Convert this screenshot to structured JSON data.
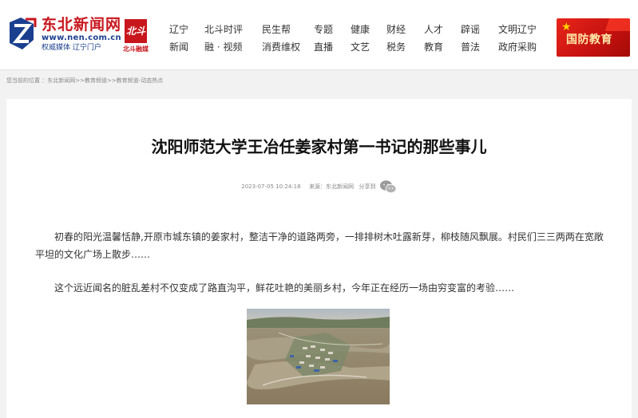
{
  "site": {
    "name": "东北新闻网",
    "url": "www.nen.com.cn",
    "tagline": "权威媒体  辽宁门户",
    "partner_mark": "北斗",
    "partner_label": "北斗融媒"
  },
  "nav": {
    "row1": [
      "辽宁",
      "北斗时评",
      "民生帮",
      "专题",
      "健康",
      "财经",
      "人才",
      "辟谣",
      "文明辽宁"
    ],
    "row2": [
      "新闻",
      "融 · 视频",
      "消费维权",
      "直播",
      "文艺",
      "税务",
      "教育",
      "普法",
      "政府采购"
    ]
  },
  "banner": {
    "text": "国防教育"
  },
  "breadcrumb": "您当前的位置 ：东北新闻网>>教育频道>>教育频道-动态热点",
  "article": {
    "title": "沈阳师范大学王冶任姜家村第一书记的那些事儿",
    "date": "2023-07-05 10:24:18",
    "source": "来源：东北新闻网",
    "share_label": "分享到",
    "paragraphs": [
      "初春的阳光温馨恬静,开原市城东镇的姜家村，整洁干净的道路两旁，一排排树木吐露新芽，柳枝随风飘展。村民们三三两两在宽敞平坦的文化广场上散步……",
      "这个远近闻名的脏乱差村不仅变成了路直沟平，鲜花吐艳的美丽乡村，今年正在经历一场由穷变富的考验……"
    ]
  },
  "icons": {
    "share": "wechat-icon",
    "logo": "nen-logo-icon"
  },
  "colors": {
    "brand_red": "#c8161d",
    "brand_blue": "#1b3f8f",
    "banner_red": "#d4170f"
  }
}
